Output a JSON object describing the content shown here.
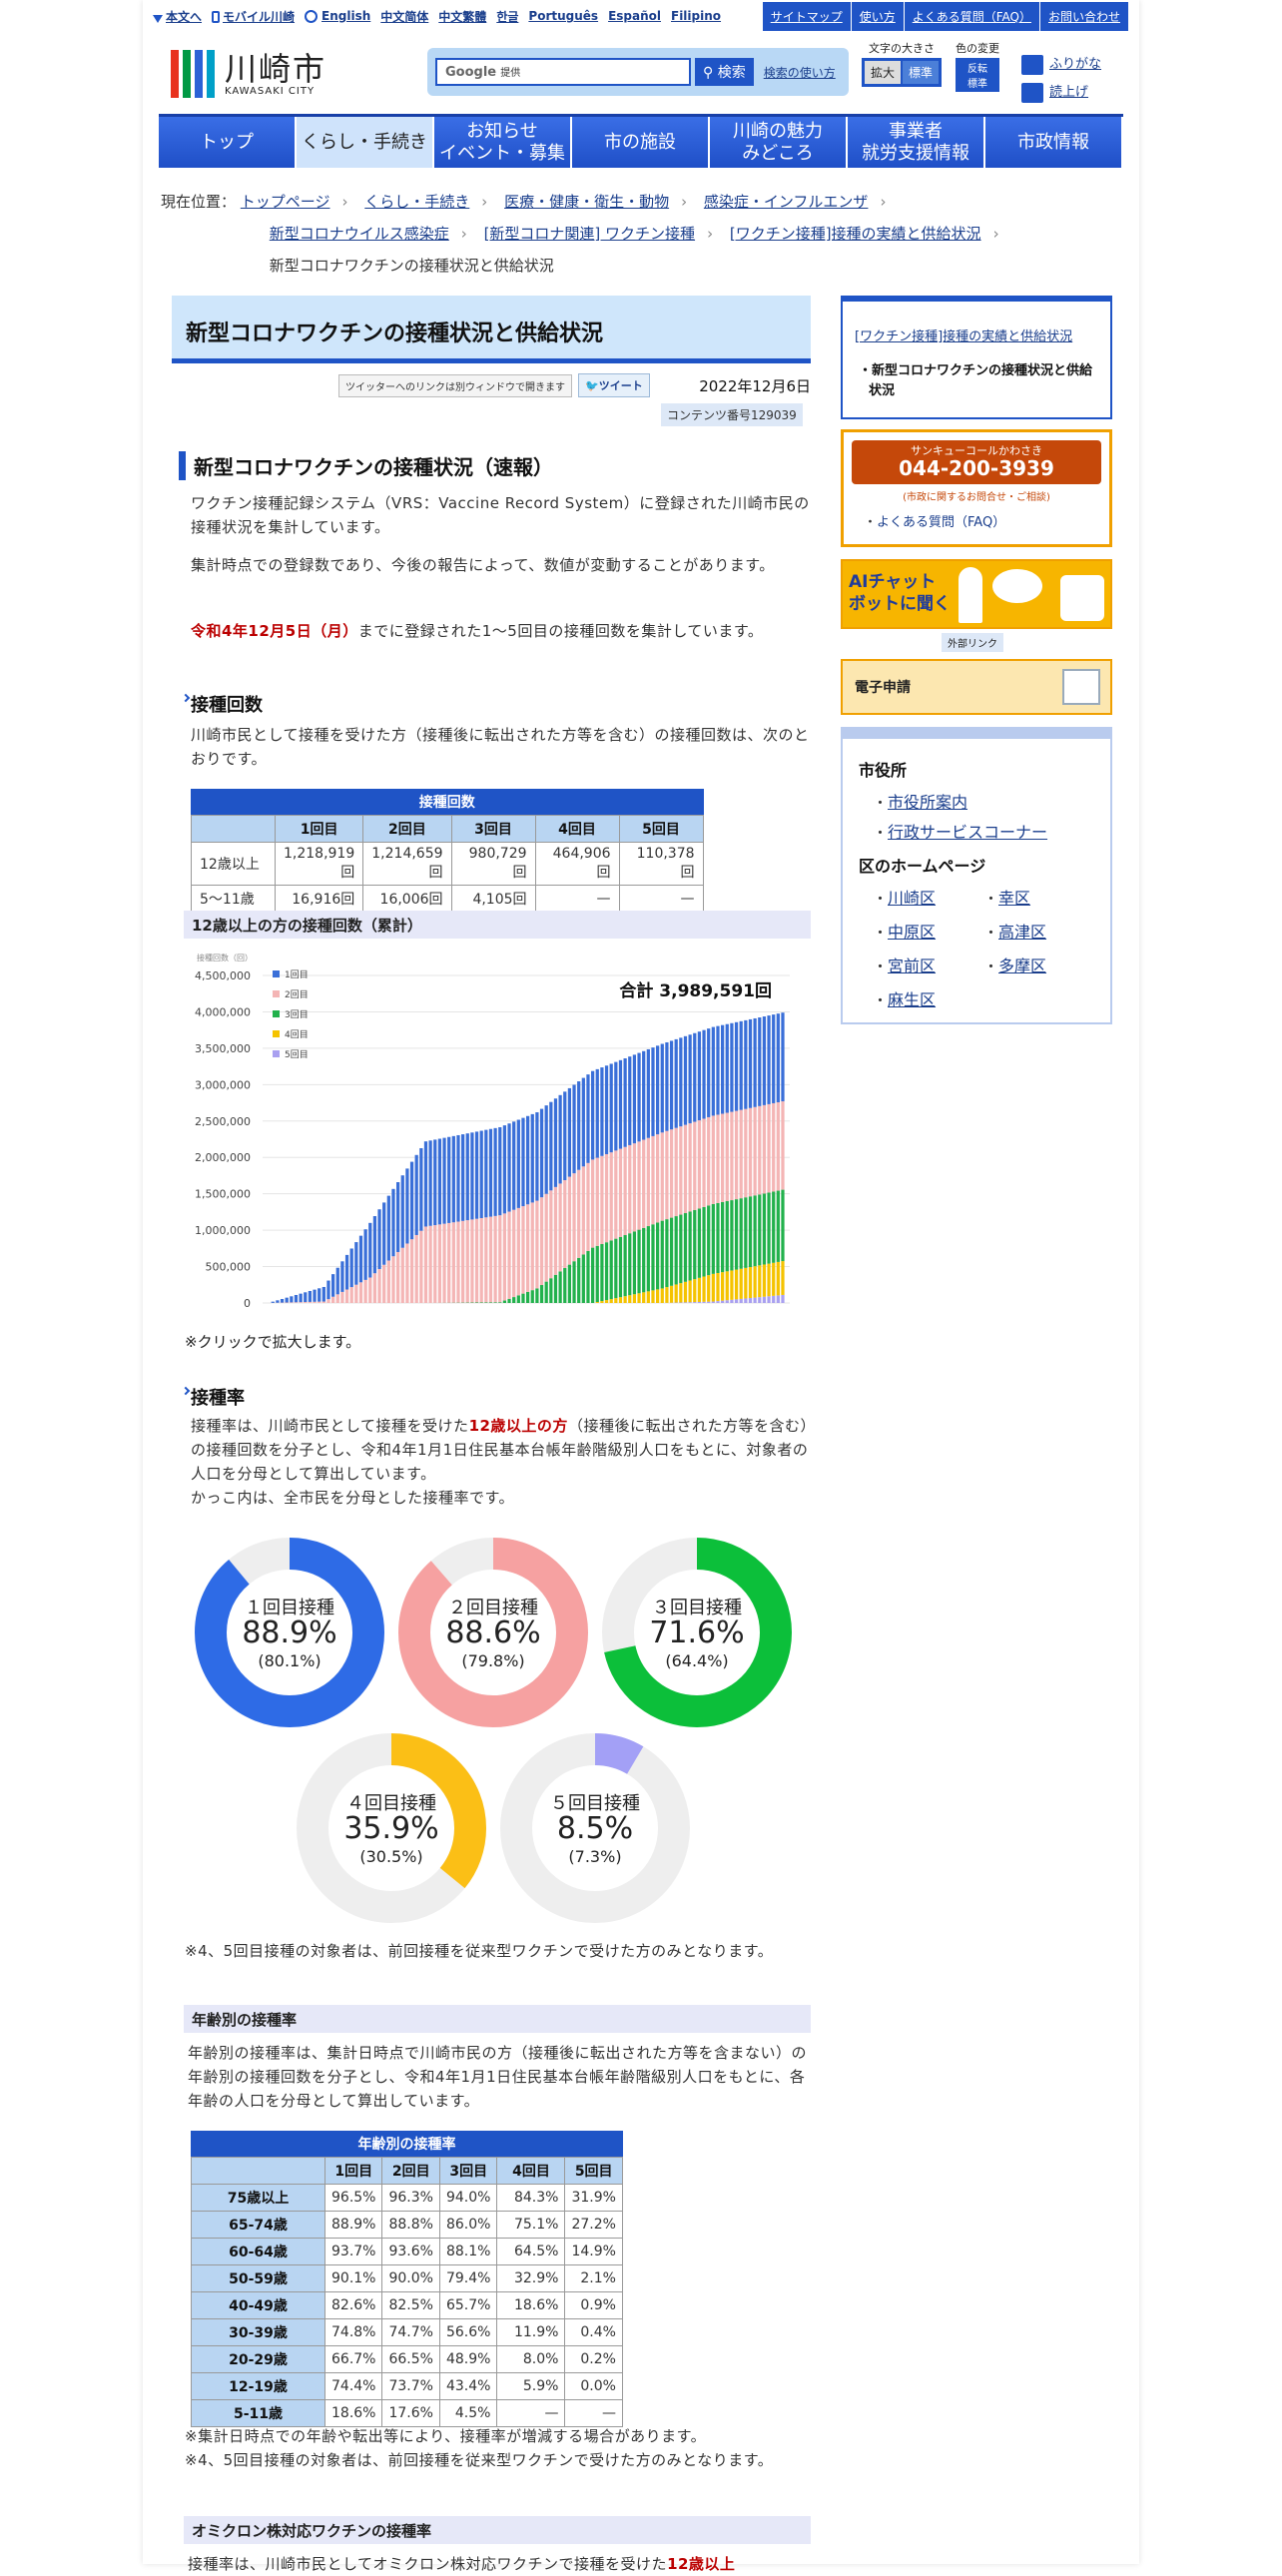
{
  "util": {
    "skip": "本文へ",
    "mobile": "モバイル川崎",
    "langs": [
      "English",
      "中文简体",
      "中文繁體",
      "한글",
      "Português",
      "Español",
      "Filipino"
    ]
  },
  "topnav": [
    "サイトマップ",
    "使い方",
    "よくある質問（FAQ）",
    "お問い合わせ"
  ],
  "logo": {
    "jp": "川崎市",
    "en": "KAWASAKI CITY",
    "colors": [
      "#e8321e",
      "#009944",
      "#2b62d6",
      "#00a0c8"
    ]
  },
  "search": {
    "engine": "Google",
    "placeholder": "提供",
    "button": "検索",
    "help": "検索の使い方"
  },
  "tools": {
    "size_label": "文字の大きさ",
    "enlarge": "拡大",
    "standard": "標準",
    "color_label": "色の変更",
    "invert": "反転",
    "color_std": "標準",
    "furigana": "ふりがな",
    "readaloud": "読上げ"
  },
  "mainnav": [
    "トップ",
    "くらし・手続き",
    "お知らせ\nイベント・募集",
    "市の施設",
    "川崎の魅力\nみどころ",
    "事業者\n就労支援情報",
    "市政情報"
  ],
  "breadcrumb": {
    "label": "現在位置：",
    "items": [
      "トップページ",
      "くらし・手続き",
      "医療・健康・衛生・動物",
      "感染症・インフルエンザ",
      "新型コロナウイルス感染症",
      "[新型コロナ関連] ワクチン接種",
      "[ワクチン接種]接種の実績と供給状況"
    ],
    "current": "新型コロナワクチンの接種状況と供給状況"
  },
  "page": {
    "title": "新型コロナワクチンの接種状況と供給状況",
    "share_note": "ツイッターへのリンクは別ウィンドウで開きます",
    "tweet": "ツイート",
    "date": "2022年12月6日",
    "content_no": "コンテンツ番号129039"
  },
  "sec1": {
    "heading": "新型コロナワクチンの接種状況（速報）",
    "p1": "ワクチン接種記録システム（VRS：Vaccine Record System）に登録された川崎市民の接種状況を集計しています。",
    "p2": "集計時点での登録数であり、今後の報告によって、数値が変動することがあります。",
    "p3_red": "令和4年12月5日（月）",
    "p3": "までに登録された1～5回目の接種回数を集計しています。"
  },
  "count": {
    "heading": "接種回数",
    "text": "川崎市民として接種を受けた方（接種後に転出された方等を含む）の接種回数は、次のとおりです。",
    "caption": "接種回数",
    "cols": [
      "",
      "1回目",
      "2回目",
      "3回目",
      "4回目",
      "5回目"
    ],
    "rows": [
      [
        "12歳以上",
        "1,218,919回",
        "1,214,659回",
        "980,729回",
        "464,906回",
        "110,378回"
      ],
      [
        "5～11歳",
        "16,916回",
        "16,006回",
        "4,105回",
        "—",
        "—"
      ]
    ]
  },
  "chart_title": "12歳以上の方の接種回数（累計）",
  "chart_data": {
    "type": "bar",
    "title": "合計 3,989,591回",
    "ylabel": "接種回数（回）",
    "ylim": [
      0,
      4500000
    ],
    "yticks": [
      0,
      500000,
      1000000,
      1500000,
      2000000,
      2500000,
      3000000,
      3500000,
      4000000,
      4500000
    ],
    "series": [
      {
        "name": "1回目",
        "color": "#3a6fd8"
      },
      {
        "name": "2回目",
        "color": "#f4b5b5"
      },
      {
        "name": "3回目",
        "color": "#22b14c"
      },
      {
        "name": "4回目",
        "color": "#f5c300"
      },
      {
        "name": "5回目",
        "color": "#a9a0f0"
      }
    ]
  },
  "click_note": "※クリックで拡大します。",
  "rate": {
    "heading": "接種率",
    "t1": "接種率は、川崎市民として接種を受けた",
    "t_red": "12歳以上の方",
    "t2": "（接種後に転出された方等を含む）の接種回数を分子とし、令和4年1月1日住民基本台帳年齢階級別人口をもとに、対象者の人口を分母として算出しています。",
    "t3": "かっこ内は、全市民を分母とした接種率です。"
  },
  "donuts": [
    {
      "label": "１回目接種",
      "pct": "88.9%",
      "sub": "(80.1%)",
      "value": 0.889,
      "color": "#2e6be6"
    },
    {
      "label": "２回目接種",
      "pct": "88.6%",
      "sub": "(79.8%)",
      "value": 0.886,
      "color": "#f6a1a1"
    },
    {
      "label": "３回目接種",
      "pct": "71.6%",
      "sub": "(64.4%)",
      "value": 0.716,
      "color": "#0cbf3a"
    },
    {
      "label": "４回目接種",
      "pct": "35.9%",
      "sub": "(30.5%)",
      "value": 0.359,
      "color": "#fbbf16"
    },
    {
      "label": "５回目接種",
      "pct": "8.5%",
      "sub": "(7.3%)",
      "value": 0.085,
      "color": "#a3a0f6"
    }
  ],
  "donut_note": "※4、5回目接種の対象者は、前回接種を従来型ワクチンで受けた方のみとなります。",
  "age": {
    "heading": "年齢別の接種率",
    "text": "年齢別の接種率は、集計日時点で川崎市民の方（接種後に転出された方等を含まない）の年齢別の接種回数を分子とし、令和4年1月1日住民基本台帳年齢階級別人口をもとに、各年齢の人口を分母として算出しています。",
    "caption": "年齢別の接種率",
    "cols": [
      "",
      "1回目",
      "2回目",
      "3回目",
      "4回目",
      "5回目"
    ],
    "rows": [
      [
        "75歳以上",
        "96.5%",
        "96.3%",
        "94.0%",
        "84.3%",
        "31.9%"
      ],
      [
        "65-74歳",
        "88.9%",
        "88.8%",
        "86.0%",
        "75.1%",
        "27.2%"
      ],
      [
        "60-64歳",
        "93.7%",
        "93.6%",
        "88.1%",
        "64.5%",
        "14.9%"
      ],
      [
        "50-59歳",
        "90.1%",
        "90.0%",
        "79.4%",
        "32.9%",
        "2.1%"
      ],
      [
        "40-49歳",
        "82.6%",
        "82.5%",
        "65.7%",
        "18.6%",
        "0.9%"
      ],
      [
        "30-39歳",
        "74.8%",
        "74.7%",
        "56.6%",
        "11.9%",
        "0.4%"
      ],
      [
        "20-29歳",
        "66.7%",
        "66.5%",
        "48.9%",
        "8.0%",
        "0.2%"
      ],
      [
        "12-19歳",
        "74.4%",
        "73.7%",
        "43.4%",
        "5.9%",
        "0.0%"
      ],
      [
        "5-11歳",
        "18.6%",
        "17.6%",
        "4.5%",
        "—",
        "—"
      ]
    ],
    "note1": "※集計日時点での年齢や転出等により、接種率が増減する場合があります。",
    "note2": "※4、5回目接種の対象者は、前回接種を従来型ワクチンで受けた方のみとなります。"
  },
  "omicron": {
    "heading": "オミクロン株対応ワクチンの接種率",
    "text": "接種率は、川崎市民としてオミクロン株対応ワクチンで接種を受けた",
    "red": "12歳以上"
  },
  "side": {
    "link1": "[ワクチン接種]接種の実績と供給状況",
    "current": "新型コロナワクチンの接種状況と供給状況",
    "call_title": "サンキューコールかわさき",
    "call_no": "044-200-3939",
    "call_sub": "(市政に関するお問合せ・ご相談)",
    "faq": "よくある質問（FAQ）",
    "ai1": "AIチャット",
    "ai2": "ボットに聞く",
    "ext": "外部リンク",
    "eapp": "電子申請",
    "cityhall": "市役所",
    "ch_links": [
      "市役所案内",
      "行政サービスコーナー"
    ],
    "wards_head": "区のホームページ",
    "wards": [
      "川崎区",
      "幸区",
      "中原区",
      "高津区",
      "宮前区",
      "多摩区",
      "麻生区"
    ]
  }
}
